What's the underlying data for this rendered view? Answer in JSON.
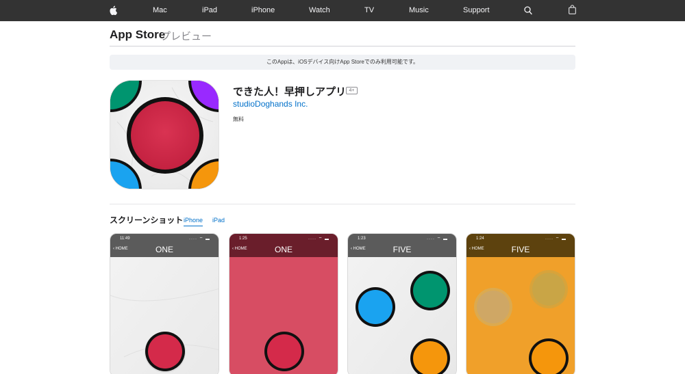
{
  "global_nav": {
    "items": [
      "Mac",
      "iPad",
      "iPhone",
      "Watch",
      "TV",
      "Music",
      "Support"
    ],
    "icons": [
      "apple-logo-icon",
      "search-icon",
      "bag-icon"
    ]
  },
  "local_nav": {
    "brand": "App Store",
    "brand_sub": "プレビュー"
  },
  "notice": "このAppは、iOSデバイス向けApp Storeでのみ利用可能です。",
  "app": {
    "title": "できた人！早押しアプリ",
    "age_rating": "4+",
    "developer": "studioDoghands Inc.",
    "price": "無料",
    "icon_colors": {
      "corner_top_left": "#00956f",
      "corner_top_right": "#9929ff",
      "corner_bottom_left": "#1aa3f0",
      "corner_bottom_right": "#f5960c",
      "center_button": "#d42a4a"
    }
  },
  "screenshots": {
    "heading": "スクリーンショット",
    "tabs": [
      {
        "label": "iPhone",
        "active": true
      },
      {
        "label": "iPad",
        "active": false
      }
    ],
    "items": [
      {
        "time": "11:49",
        "status": "···· ⌔ ▬",
        "home": "HOME",
        "title": "ONE",
        "header_color": "#5b5b5b",
        "background": "marble"
      },
      {
        "time": "1:25",
        "status": "···· ⌔ ▬",
        "home": "HOME",
        "title": "ONE",
        "header_color": "#6a1e2b",
        "background": "#d74d63"
      },
      {
        "time": "1:23",
        "status": "···· ⌔ ▬",
        "home": "HOME",
        "title": "FIVE",
        "header_color": "#5b5b5b",
        "background": "marble"
      },
      {
        "time": "1:24",
        "status": "···· ⌔ ▬",
        "home": "HOME",
        "title": "FIVE",
        "header_color": "#5d420e",
        "background": "#f0a02a"
      }
    ]
  }
}
